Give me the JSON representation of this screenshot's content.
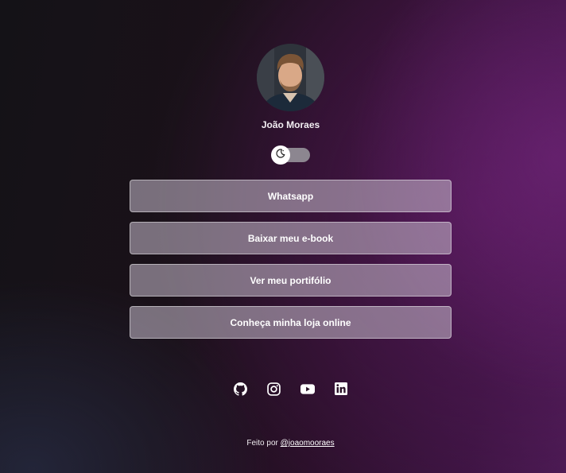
{
  "profile": {
    "name": "João Moraes",
    "avatar_icon": "profile-photo"
  },
  "theme_toggle": {
    "icon": "moon-icon",
    "state": "off"
  },
  "links": [
    {
      "label": "Whatsapp"
    },
    {
      "label": "Baixar meu e-book"
    },
    {
      "label": "Ver meu portifólio"
    },
    {
      "label": "Conheça minha loja online"
    }
  ],
  "socials": [
    {
      "icon": "github-icon"
    },
    {
      "icon": "instagram-icon"
    },
    {
      "icon": "youtube-icon"
    },
    {
      "icon": "linkedin-icon"
    }
  ],
  "footer": {
    "prefix": "Feito por",
    "handle": "@joaomooraes"
  }
}
